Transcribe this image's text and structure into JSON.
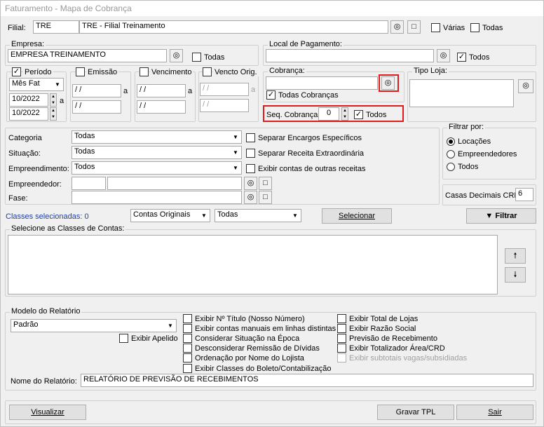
{
  "window": {
    "title": "Faturamento - Mapa de Cobrança"
  },
  "filial": {
    "label": "Filial:",
    "code": "TRE",
    "name": "TRE - Filial Treinamento",
    "varias": "Várias",
    "todas": "Todas"
  },
  "empresa": {
    "group": "Empresa:",
    "value": "EMPRESA TREINAMENTO",
    "todas": "Todas"
  },
  "local": {
    "group": "Local de Pagamento:",
    "value": "",
    "todos": "Todos"
  },
  "periodo": {
    "label": "Período",
    "type": "Mês Fat",
    "from": "10/2022",
    "to": "10/2022",
    "a": "a"
  },
  "emissao": {
    "label": "Emissão",
    "from": " / /",
    "to": " / /",
    "a": "a"
  },
  "vencimento": {
    "label": "Vencimento",
    "from": " / /",
    "to": " / /",
    "a": "a"
  },
  "vencto_orig": {
    "label": "Vencto Orig.",
    "from": " / /",
    "to": " / /",
    "a": "a"
  },
  "cobranca": {
    "group": "Cobrança:",
    "value": "",
    "todas": "Todas Cobranças"
  },
  "seq": {
    "label": "Seq. Cobrança:",
    "value": "0",
    "todos": "Todos"
  },
  "tipo_loja": {
    "group": "Tipo Loja:"
  },
  "filters": {
    "categoria": {
      "label": "Categoria",
      "value": "Todas"
    },
    "situacao": {
      "label": "Situação:",
      "value": "Todas"
    },
    "empreendimento": {
      "label": "Empreendimento:",
      "value": "Todos"
    },
    "empreendedor": {
      "label": "Empreendedor:"
    },
    "fase": {
      "label": "Fase:"
    },
    "separar_encargos": "Separar Encargos Específicos",
    "separar_receita": "Separar Receita Extraordinária",
    "exibir_contas": "Exibir contas de outras receitas"
  },
  "filtrar_por": {
    "group": "Filtrar por:",
    "options": [
      "Locações",
      "Empreendedores",
      "Todos"
    ]
  },
  "casas": {
    "label": "Casas Decimais CRD",
    "value": "6"
  },
  "classes": {
    "selected": "Classes selecionadas: 0",
    "combo1": "Contas Originais",
    "combo2": "Todas",
    "selecionar": "Selecionar",
    "filtrar": "Filtrar",
    "group": "Selecione as Classes de Contas:"
  },
  "modelo": {
    "group": "Modelo do Relatório",
    "value": "Padrão",
    "exibir_apelido": "Exibir Apelido",
    "nome_label": "Nome do Relatório:",
    "nome_value": "RELATÓRIO DE PREVISÃO DE RECEBIMENTOS"
  },
  "options_col1": [
    "Exibir Nº Título (Nosso Número)",
    "Exibir contas manuais em linhas distintas",
    "Considerar Situação na Época",
    "Desconsiderar Remissão de Dívidas",
    "Ordenação por Nome do Lojista",
    "Exibir Classes do Boleto/Contabilização"
  ],
  "options_col2": [
    "Exibir Total de Lojas",
    "Exibir Razão Social",
    "Previsão de Recebimento",
    "Exibir Totalizador Área/CRD",
    "Exibir subtotais vagas/subsidiadas"
  ],
  "footer": {
    "visualizar": "Visualizar",
    "gravar": "Gravar TPL",
    "sair": "Sair"
  },
  "icons": {
    "binoculars": "binoculars-icon",
    "new": "new-doc-icon"
  }
}
